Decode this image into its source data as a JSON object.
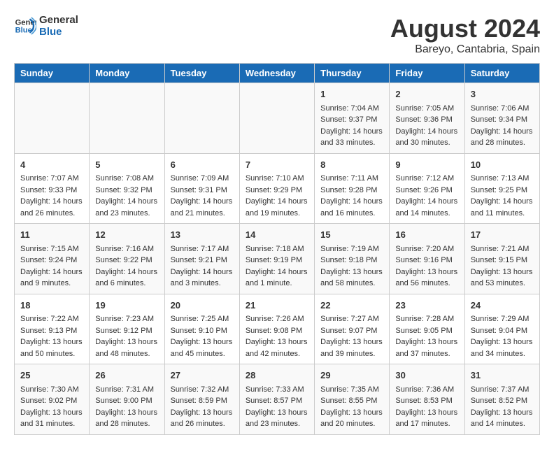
{
  "logo": {
    "line1": "General",
    "line2": "Blue"
  },
  "title": "August 2024",
  "subtitle": "Bareyo, Cantabria, Spain",
  "weekdays": [
    "Sunday",
    "Monday",
    "Tuesday",
    "Wednesday",
    "Thursday",
    "Friday",
    "Saturday"
  ],
  "weeks": [
    [
      {
        "day": "",
        "content": ""
      },
      {
        "day": "",
        "content": ""
      },
      {
        "day": "",
        "content": ""
      },
      {
        "day": "",
        "content": ""
      },
      {
        "day": "1",
        "content": "Sunrise: 7:04 AM\nSunset: 9:37 PM\nDaylight: 14 hours\nand 33 minutes."
      },
      {
        "day": "2",
        "content": "Sunrise: 7:05 AM\nSunset: 9:36 PM\nDaylight: 14 hours\nand 30 minutes."
      },
      {
        "day": "3",
        "content": "Sunrise: 7:06 AM\nSunset: 9:34 PM\nDaylight: 14 hours\nand 28 minutes."
      }
    ],
    [
      {
        "day": "4",
        "content": "Sunrise: 7:07 AM\nSunset: 9:33 PM\nDaylight: 14 hours\nand 26 minutes."
      },
      {
        "day": "5",
        "content": "Sunrise: 7:08 AM\nSunset: 9:32 PM\nDaylight: 14 hours\nand 23 minutes."
      },
      {
        "day": "6",
        "content": "Sunrise: 7:09 AM\nSunset: 9:31 PM\nDaylight: 14 hours\nand 21 minutes."
      },
      {
        "day": "7",
        "content": "Sunrise: 7:10 AM\nSunset: 9:29 PM\nDaylight: 14 hours\nand 19 minutes."
      },
      {
        "day": "8",
        "content": "Sunrise: 7:11 AM\nSunset: 9:28 PM\nDaylight: 14 hours\nand 16 minutes."
      },
      {
        "day": "9",
        "content": "Sunrise: 7:12 AM\nSunset: 9:26 PM\nDaylight: 14 hours\nand 14 minutes."
      },
      {
        "day": "10",
        "content": "Sunrise: 7:13 AM\nSunset: 9:25 PM\nDaylight: 14 hours\nand 11 minutes."
      }
    ],
    [
      {
        "day": "11",
        "content": "Sunrise: 7:15 AM\nSunset: 9:24 PM\nDaylight: 14 hours\nand 9 minutes."
      },
      {
        "day": "12",
        "content": "Sunrise: 7:16 AM\nSunset: 9:22 PM\nDaylight: 14 hours\nand 6 minutes."
      },
      {
        "day": "13",
        "content": "Sunrise: 7:17 AM\nSunset: 9:21 PM\nDaylight: 14 hours\nand 3 minutes."
      },
      {
        "day": "14",
        "content": "Sunrise: 7:18 AM\nSunset: 9:19 PM\nDaylight: 14 hours\nand 1 minute."
      },
      {
        "day": "15",
        "content": "Sunrise: 7:19 AM\nSunset: 9:18 PM\nDaylight: 13 hours\nand 58 minutes."
      },
      {
        "day": "16",
        "content": "Sunrise: 7:20 AM\nSunset: 9:16 PM\nDaylight: 13 hours\nand 56 minutes."
      },
      {
        "day": "17",
        "content": "Sunrise: 7:21 AM\nSunset: 9:15 PM\nDaylight: 13 hours\nand 53 minutes."
      }
    ],
    [
      {
        "day": "18",
        "content": "Sunrise: 7:22 AM\nSunset: 9:13 PM\nDaylight: 13 hours\nand 50 minutes."
      },
      {
        "day": "19",
        "content": "Sunrise: 7:23 AM\nSunset: 9:12 PM\nDaylight: 13 hours\nand 48 minutes."
      },
      {
        "day": "20",
        "content": "Sunrise: 7:25 AM\nSunset: 9:10 PM\nDaylight: 13 hours\nand 45 minutes."
      },
      {
        "day": "21",
        "content": "Sunrise: 7:26 AM\nSunset: 9:08 PM\nDaylight: 13 hours\nand 42 minutes."
      },
      {
        "day": "22",
        "content": "Sunrise: 7:27 AM\nSunset: 9:07 PM\nDaylight: 13 hours\nand 39 minutes."
      },
      {
        "day": "23",
        "content": "Sunrise: 7:28 AM\nSunset: 9:05 PM\nDaylight: 13 hours\nand 37 minutes."
      },
      {
        "day": "24",
        "content": "Sunrise: 7:29 AM\nSunset: 9:04 PM\nDaylight: 13 hours\nand 34 minutes."
      }
    ],
    [
      {
        "day": "25",
        "content": "Sunrise: 7:30 AM\nSunset: 9:02 PM\nDaylight: 13 hours\nand 31 minutes."
      },
      {
        "day": "26",
        "content": "Sunrise: 7:31 AM\nSunset: 9:00 PM\nDaylight: 13 hours\nand 28 minutes."
      },
      {
        "day": "27",
        "content": "Sunrise: 7:32 AM\nSunset: 8:59 PM\nDaylight: 13 hours\nand 26 minutes."
      },
      {
        "day": "28",
        "content": "Sunrise: 7:33 AM\nSunset: 8:57 PM\nDaylight: 13 hours\nand 23 minutes."
      },
      {
        "day": "29",
        "content": "Sunrise: 7:35 AM\nSunset: 8:55 PM\nDaylight: 13 hours\nand 20 minutes."
      },
      {
        "day": "30",
        "content": "Sunrise: 7:36 AM\nSunset: 8:53 PM\nDaylight: 13 hours\nand 17 minutes."
      },
      {
        "day": "31",
        "content": "Sunrise: 7:37 AM\nSunset: 8:52 PM\nDaylight: 13 hours\nand 14 minutes."
      }
    ]
  ]
}
